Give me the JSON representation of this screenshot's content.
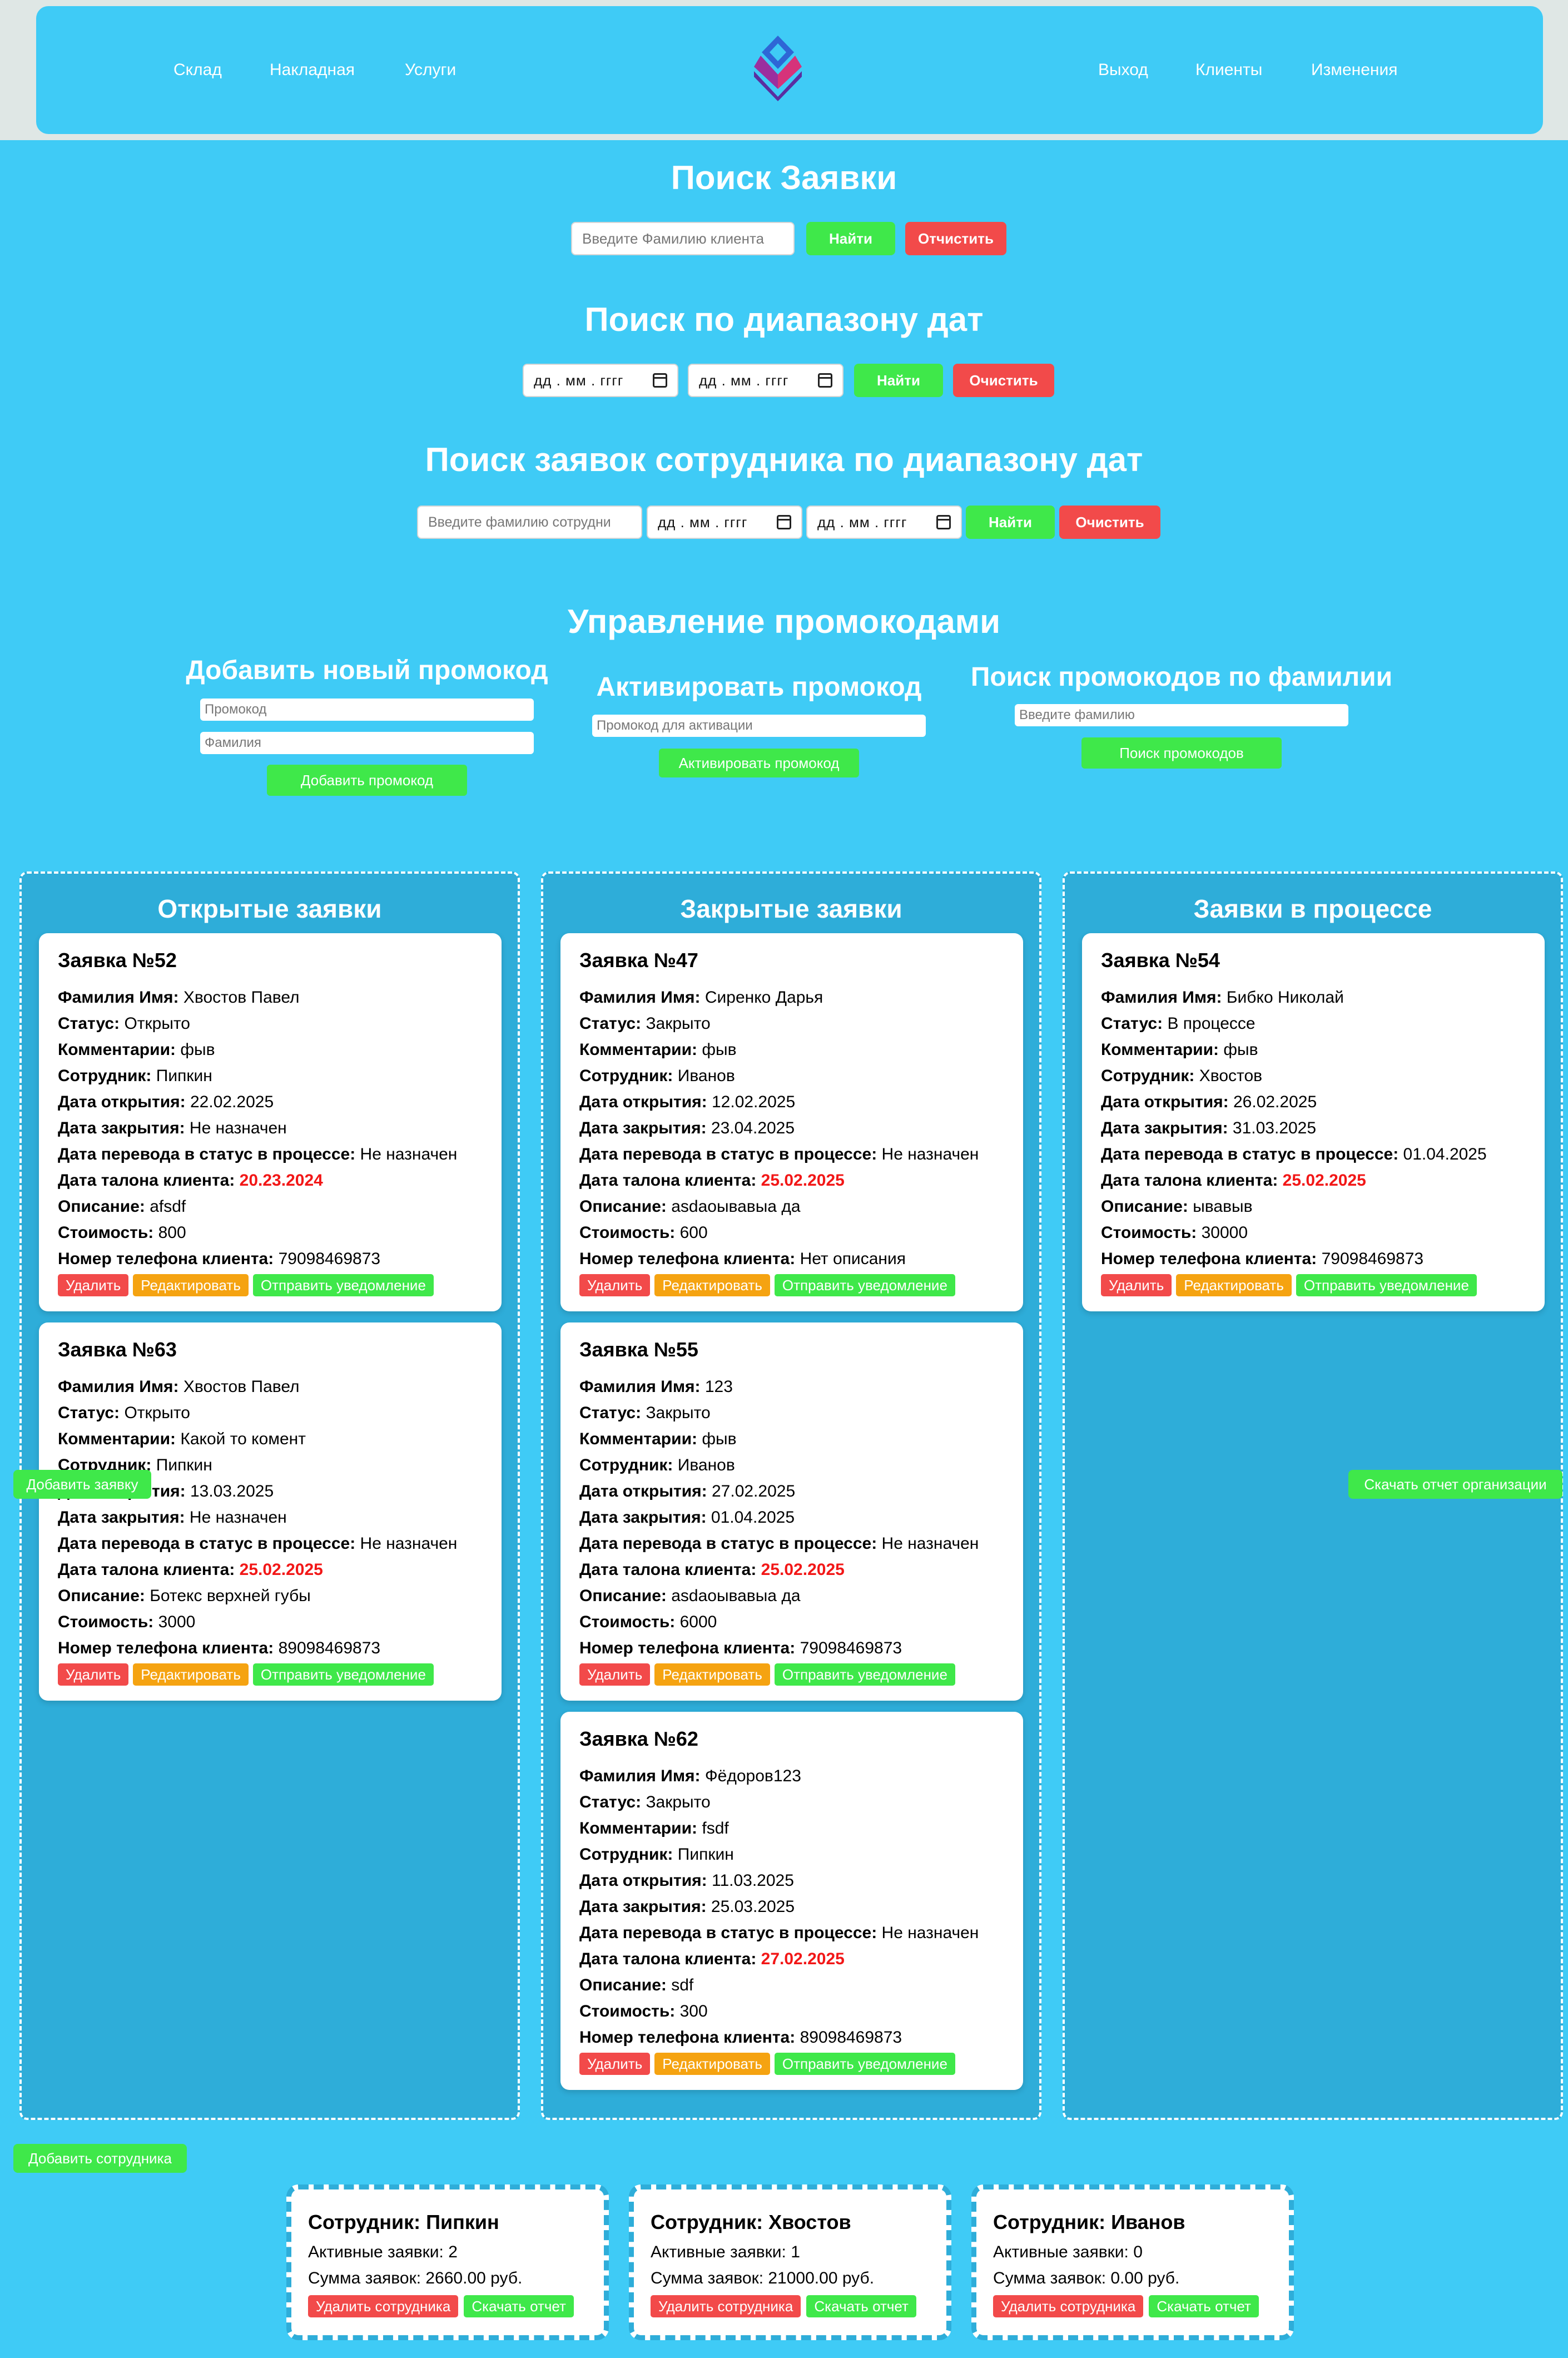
{
  "nav": {
    "left": [
      "Склад",
      "Накладная",
      "Услуги"
    ],
    "right": [
      "Выход",
      "Клиенты",
      "Изменения"
    ]
  },
  "search_request": {
    "title": "Поиск Заявки",
    "placeholder": "Введите Фамилию клиента",
    "find": "Найти",
    "clear": "Отчистить"
  },
  "search_dates": {
    "title": "Поиск по диапазону дат",
    "date_placeholder": "дд . мм . гггг",
    "find": "Найти",
    "clear": "Очистить"
  },
  "search_employee": {
    "title": "Поиск заявок сотрудника по диапазону дат",
    "placeholder": "Введите фамилию сотрудни",
    "date_placeholder": "дд . мм . гггг",
    "find": "Найти",
    "clear": "Очистить"
  },
  "promo": {
    "title": "Управление промокодами",
    "add": {
      "title": "Добавить новый промокод",
      "code_placeholder": "Промокод",
      "surname_placeholder": "Фамилия",
      "button": "Добавить промокод"
    },
    "activate": {
      "title": "Активировать промокод",
      "placeholder": "Промокод для активации",
      "button": "Активировать промокод"
    },
    "search": {
      "title": "Поиск промокодов по фамилии",
      "placeholder": "Введите фамилию",
      "button": "Поиск промокодов"
    }
  },
  "labels": {
    "name": "Фамилия Имя:",
    "status": "Статус:",
    "comments": "Комментарии:",
    "employee": "Сотрудник:",
    "opened": "Дата открытия:",
    "closed": "Дата закрытия:",
    "in_progress": "Дата перевода в статус в процессе:",
    "ticket": "Дата талона клиента:",
    "description": "Описание:",
    "cost": "Стоимость:",
    "phone": "Номер телефона клиента:"
  },
  "actions": {
    "delete": "Удалить",
    "edit": "Редактировать",
    "notify": "Отправить уведомление"
  },
  "columns": [
    {
      "title": "Открытые заявки",
      "cards": [
        {
          "title": "Заявка №52",
          "name": "Хвостов Павел",
          "status": "Открыто",
          "comments": "фыв",
          "employee": "Пипкин",
          "opened": "22.02.2025",
          "closed": "Не назначен",
          "in_progress": "Не назначен",
          "ticket": "20.23.2024",
          "description": "afsdf",
          "cost": "800",
          "phone": "79098469873"
        },
        {
          "title": "Заявка №63",
          "name": "Хвостов Павел",
          "status": "Открыто",
          "comments": "Какой то комент",
          "employee": "Пипкин",
          "opened": "13.03.2025",
          "closed": "Не назначен",
          "in_progress": "Не назначен",
          "ticket": "25.02.2025",
          "description": "Ботекс верхней губы",
          "cost": "3000",
          "phone": "89098469873"
        }
      ]
    },
    {
      "title": "Закрытые заявки",
      "cards": [
        {
          "title": "Заявка №47",
          "name": "Сиренко Дарья",
          "status": "Закрыто",
          "comments": "фыв",
          "employee": "Иванов",
          "opened": "12.02.2025",
          "closed": "23.04.2025",
          "in_progress": "Не назначен",
          "ticket": "25.02.2025",
          "description": "asdaoывавыа да",
          "cost": "600",
          "phone": "Нет описания"
        },
        {
          "title": "Заявка №55",
          "name": "123",
          "status": "Закрыто",
          "comments": "фыв",
          "employee": "Иванов",
          "opened": "27.02.2025",
          "closed": "01.04.2025",
          "in_progress": "Не назначен",
          "ticket": "25.02.2025",
          "description": "asdaoывавыа да",
          "cost": "6000",
          "phone": "79098469873"
        },
        {
          "title": "Заявка №62",
          "name": "Фёдоров123",
          "status": "Закрыто",
          "comments": "fsdf",
          "employee": "Пипкин",
          "opened": "11.03.2025",
          "closed": "25.03.2025",
          "in_progress": "Не назначен",
          "ticket": "27.02.2025",
          "description": "sdf",
          "cost": "300",
          "phone": "89098469873"
        }
      ]
    },
    {
      "title": "Заявки в процессе",
      "cards": [
        {
          "title": "Заявка №54",
          "name": "Бибко Николай",
          "status": "В процессе",
          "comments": "фыв",
          "employee": "Хвостов",
          "opened": "26.02.2025",
          "closed": "31.03.2025",
          "in_progress": "01.04.2025",
          "ticket": "25.02.2025",
          "description": "ывавыв",
          "cost": "30000",
          "phone": "79098469873"
        }
      ]
    }
  ],
  "buttons": {
    "add_request": "Добавить заявку",
    "download_org_report": "Скачать отчет организации",
    "add_employee": "Добавить сотрудника"
  },
  "employees": {
    "title_prefix": "Сотрудник:",
    "active_label": "Активные заявки:",
    "sum_label": "Сумма заявок:",
    "delete": "Удалить сотрудника",
    "report": "Скачать отчет",
    "items": [
      {
        "name": "Пипкин",
        "active": "2",
        "sum": "2660.00 руб."
      },
      {
        "name": "Хвостов",
        "active": "1",
        "sum": "21000.00 руб."
      },
      {
        "name": "Иванов",
        "active": "0",
        "sum": "0.00 руб."
      }
    ]
  },
  "colors": {
    "background": "#3fcbf6",
    "column": "#2eadd9",
    "green": "#3fe84a",
    "red": "#f24a4a",
    "orange": "#f5a311",
    "date_red": "#f21717"
  }
}
